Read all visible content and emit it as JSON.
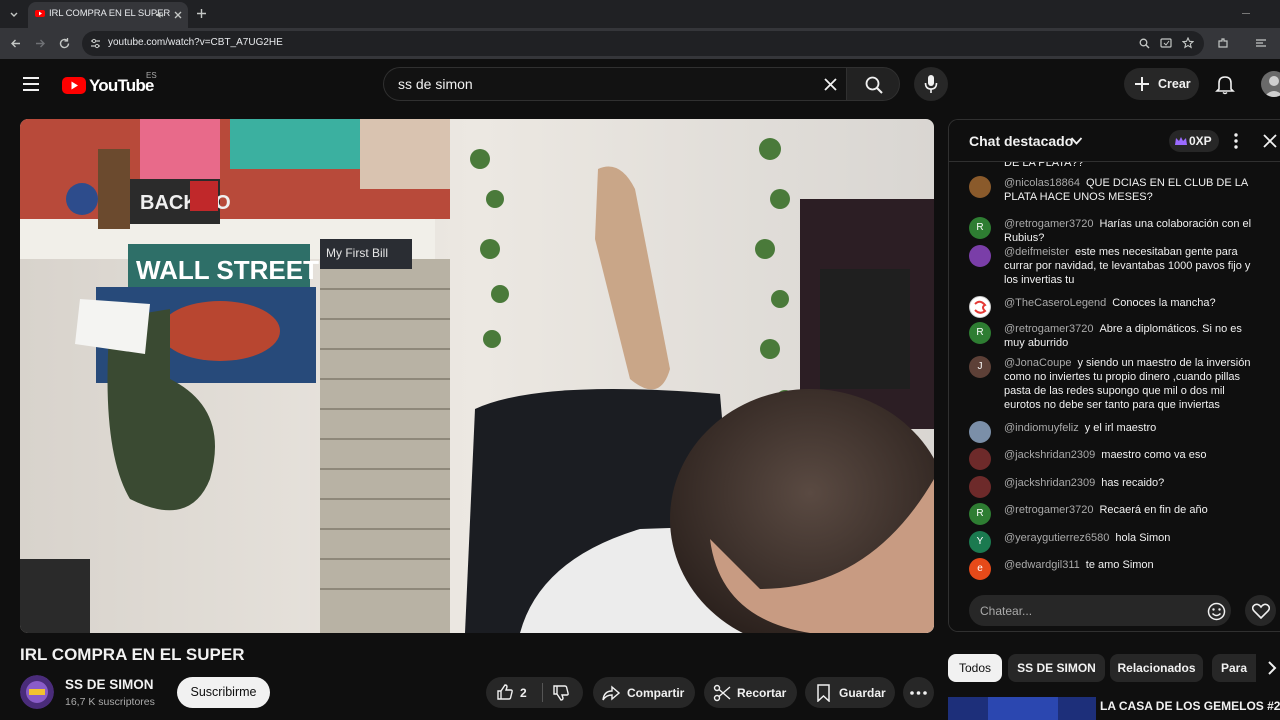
{
  "browser": {
    "tab_title": "IRL COMPRA EN EL SUPER",
    "url": "youtube.com/watch?v=CBT_A7UG2HE"
  },
  "youtube": {
    "logo_text": "YouTube",
    "region": "ES",
    "search_value": "ss de simon",
    "create_label": "Crear"
  },
  "video": {
    "title": "IRL COMPRA EN EL SUPER",
    "channel": "SS DE SIMON",
    "subscribers": "16,7 K suscriptores",
    "subscribe_label": "Suscribirme",
    "likes": "2",
    "share_label": "Compartir",
    "clip_label": "Recortar",
    "save_label": "Guardar",
    "sign_wall_street": "WALL STREET",
    "sign_back": "BACK TO",
    "sign_first_bill": "My First Bill"
  },
  "chat": {
    "title": "Chat destacado",
    "xp": "0XP",
    "placeholder": "Chatear...",
    "partial_top": "DE LA PLATA??",
    "messages": [
      {
        "author": "@nicolas18864",
        "text": "QUE DCIAS EN EL CLUB DE LA PLATA HACE UNOS MESES?",
        "avatar_color": "#8a5a2b",
        "initial": ""
      },
      {
        "author": "@retrogamer3720",
        "text": "Harías una colaboración con el Rubius?",
        "avatar_color": "#2e7d32",
        "initial": "R"
      },
      {
        "author": "@deifmeister",
        "text": "este mes necesitaban gente para currar por navidad, te levantabas 1000 pavos fijo y los invertias tu",
        "avatar_color": "#7a3ea8",
        "initial": ""
      },
      {
        "author": "@TheCaseroLegend",
        "text": "Conoces la mancha?",
        "avatar_color": "#ffffff",
        "initial": ""
      },
      {
        "author": "@retrogamer3720",
        "text": "Abre a diplomáticos. Si no es muy aburrido",
        "avatar_color": "#2e7d32",
        "initial": "R"
      },
      {
        "author": "@JonaCoupe",
        "text": "y siendo un maestro de la inversión como no inviertes tu propio dinero ,cuando pillas pasta de las redes supongo que mil o dos mil eurotos no debe ser tanto para que inviertas",
        "avatar_color": "#5d4037",
        "initial": "J"
      },
      {
        "author": "@indiomuyfeliz",
        "text": "y el irl maestro",
        "avatar_color": "#7b8fa8",
        "initial": ""
      },
      {
        "author": "@jackshridan2309",
        "text": "maestro como va eso",
        "avatar_color": "#6d2a2a",
        "initial": ""
      },
      {
        "author": "@jackshridan2309",
        "text": "has recaido?",
        "avatar_color": "#6d2a2a",
        "initial": ""
      },
      {
        "author": "@retrogamer3720",
        "text": "Recaerá en fin de año",
        "avatar_color": "#2e7d32",
        "initial": "R"
      },
      {
        "author": "@yeraygutierrez6580",
        "text": "hola Simon",
        "avatar_color": "#1b7a50",
        "initial": "Y"
      },
      {
        "author": "@edwardgil311",
        "text": "te amo Simon",
        "avatar_color": "#e64a19",
        "initial": "e"
      }
    ]
  },
  "chips": [
    "Todos",
    "SS DE SIMON",
    "Relacionados",
    "Para"
  ],
  "related": {
    "title": "LA CASA DE LOS GEMELOS #2 |"
  },
  "colors": {
    "background": "#0f0f0f",
    "youtube_red": "#ff0000",
    "pill": "#272727"
  }
}
